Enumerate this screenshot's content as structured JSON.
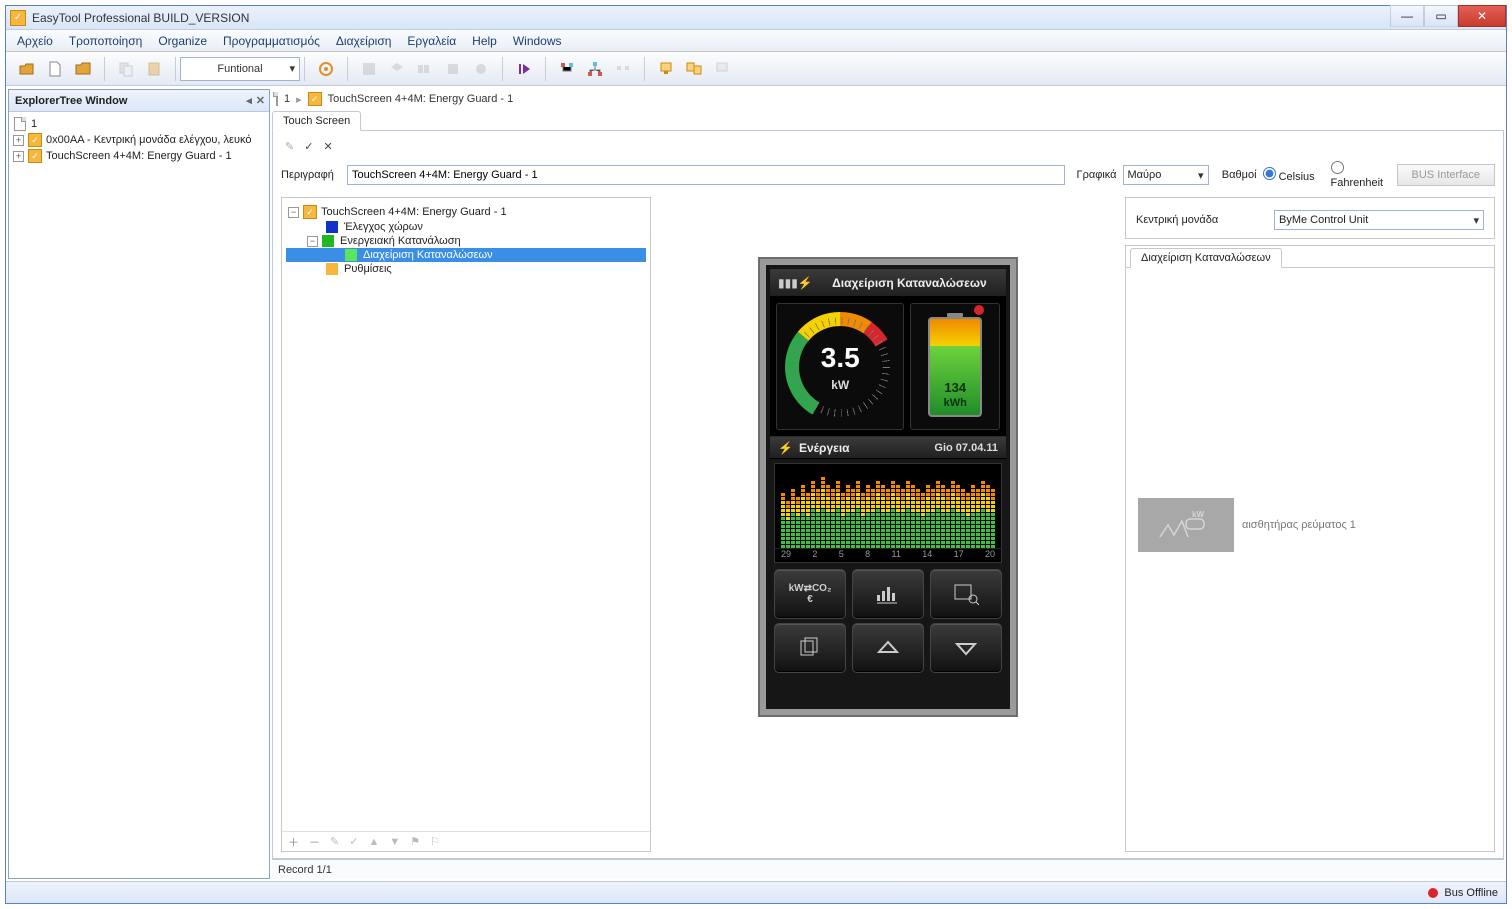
{
  "app": {
    "title": "EasyTool Professional BUILD_VERSION"
  },
  "menu": [
    "Αρχείο",
    "Τροποποίηση",
    "Organize",
    "Προγραμματισμός",
    "Διαχείριση",
    "Εργαλεία",
    "Help",
    "Windows"
  ],
  "toolbar": {
    "combo_label": "Funtional"
  },
  "explorer": {
    "title": "ExplorerTree Window",
    "root_label": "1",
    "items": [
      "0x00AA - Κεντρική μονάδα ελέγχου, λευκό",
      "TouchScreen 4+4M: Energy Guard - 1"
    ]
  },
  "crumb": {
    "root": "1",
    "leaf": "TouchScreen 4+4M: Energy Guard - 1"
  },
  "tab_label": "Touch Screen",
  "form": {
    "desc_label": "Περιγραφή",
    "desc_value": "TouchScreen 4+4M: Energy Guard - 1",
    "gfx_label": "Γραφικά",
    "gfx_value": "Μαύρο",
    "deg_label": "Βαθμοί",
    "deg_opts": [
      "Celsius",
      "Fahrenheit"
    ],
    "bus_btn": "BUS Interface"
  },
  "left_tree": {
    "root": "TouchScreen 4+4M: Energy Guard - 1",
    "n1": "Έλεγχος χώρων",
    "n2": "Ενεργειακή Κατανάλωση",
    "n2a": "Διαχείριση Καταναλώσεων",
    "n3": "Ρυθμίσεις"
  },
  "device": {
    "header": "Διαχείριση Καταναλώσεων",
    "gauge_value": "3.5",
    "gauge_unit": "kW",
    "batt_value": "134",
    "batt_unit": "kWh",
    "energy_label": "Ενέργεια",
    "energy_date": "Gio 07.04.11",
    "axis": [
      "29",
      "2",
      "5",
      "8",
      "11",
      "14",
      "17",
      "20"
    ],
    "btn1": "kW⇄CO₂ €"
  },
  "right_panel": {
    "unit_label": "Κεντρική μονάδα",
    "unit_value": "ByMe Control Unit",
    "tab_label": "Διαχείριση Καταναλώσεων",
    "sensor_thumb": "kW",
    "sensor_label": "αισθητήρας ρεύματος 1"
  },
  "record": "Record 1/1",
  "bus_status": "Bus Offline"
}
